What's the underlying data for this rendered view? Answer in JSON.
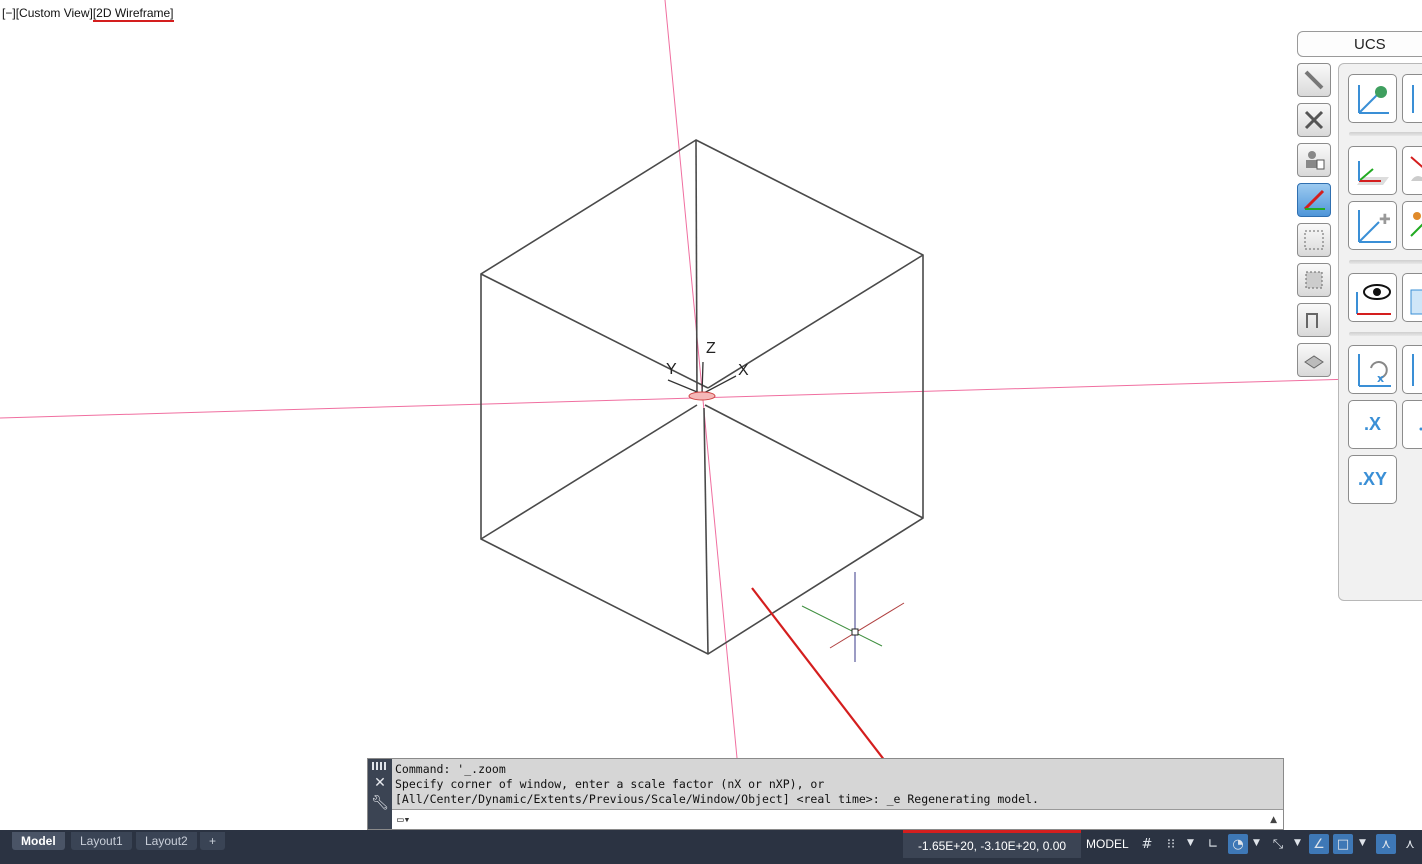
{
  "viewport": {
    "controls_label": "[−]",
    "view_label": "[Custom View]",
    "visual_style_label": "[2D Wireframe]",
    "axis_labels": {
      "x": "X",
      "y": "Y",
      "z": "Z"
    }
  },
  "ucs_palette": {
    "title": "UCS",
    "buttons": {
      "x_label": ".X",
      "xy_label": ".XY"
    }
  },
  "command_line": {
    "history": [
      "Command: '_.zoom",
      "Specify corner of window, enter a scale factor (nX or nXP), or",
      "[All/Center/Dynamic/Extents/Previous/Scale/Window/Object] <real time>: _e Regenerating model."
    ],
    "input_value": "",
    "input_placeholder": ""
  },
  "layout_tabs": [
    {
      "label": "Model",
      "active": true
    },
    {
      "label": "Layout1",
      "active": false
    },
    {
      "label": "Layout2",
      "active": false
    }
  ],
  "add_tab_label": "+",
  "status_bar": {
    "coordinates": "-1.65E+20, -3.10E+20, 0.00",
    "space_label": "MODEL"
  },
  "colors": {
    "annotation_red": "#d41e1e",
    "axis_line_pink": "#f06fa0",
    "wireframe": "#4a4a4a",
    "statusbar_bg": "#2b3342",
    "highlight_blue": "#3e78b6"
  }
}
